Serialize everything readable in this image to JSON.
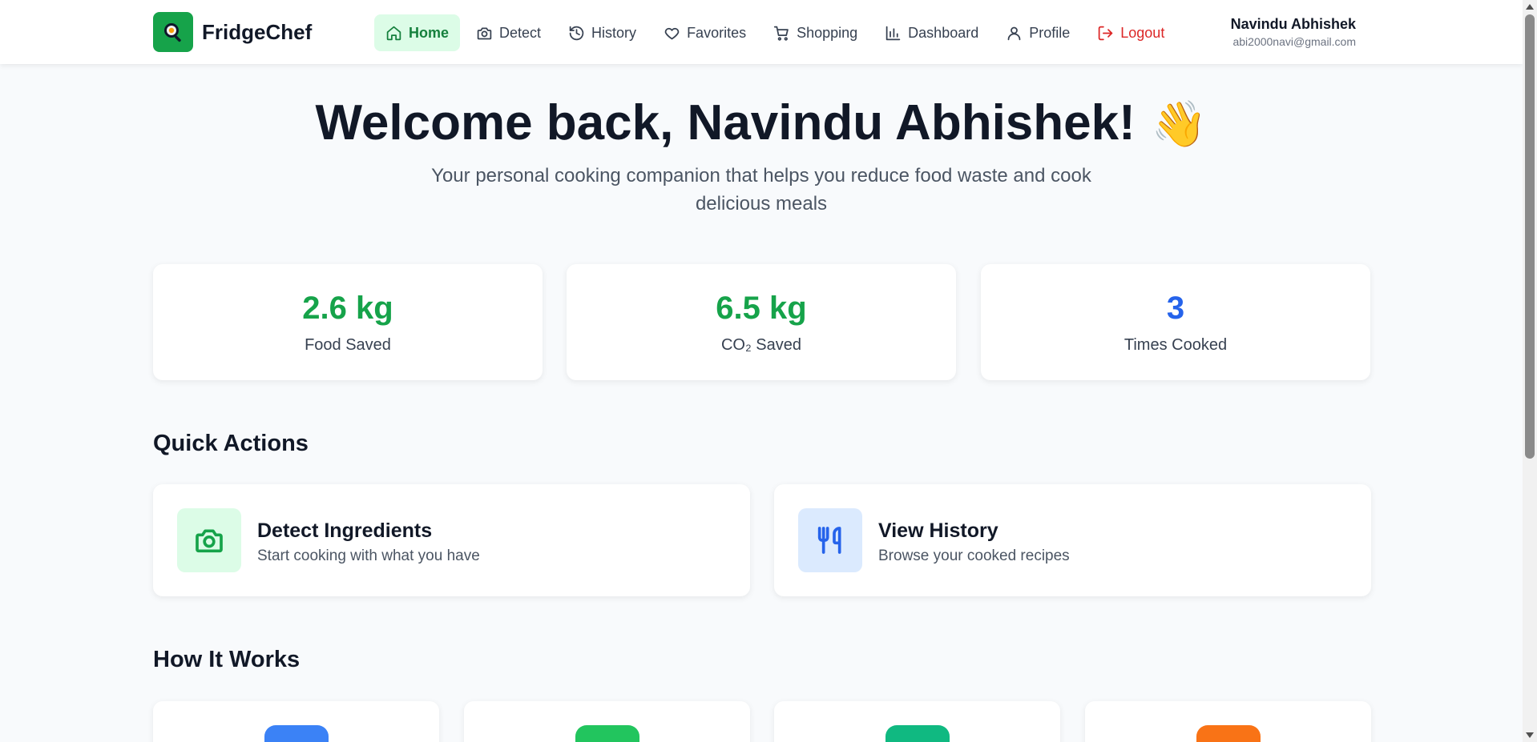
{
  "app": {
    "name": "FridgeChef",
    "logo_icon": "pan-icon"
  },
  "nav": {
    "items": [
      {
        "label": "Home",
        "icon": "home-icon",
        "active": true
      },
      {
        "label": "Detect",
        "icon": "camera-icon"
      },
      {
        "label": "History",
        "icon": "history-icon"
      },
      {
        "label": "Favorites",
        "icon": "heart-icon"
      },
      {
        "label": "Shopping",
        "icon": "cart-icon"
      },
      {
        "label": "Dashboard",
        "icon": "bar-chart-icon"
      },
      {
        "label": "Profile",
        "icon": "user-icon"
      },
      {
        "label": "Logout",
        "icon": "logout-icon"
      }
    ]
  },
  "user": {
    "name": "Navindu Abhishek",
    "email": "abi2000navi@gmail.com"
  },
  "hero": {
    "title": "Welcome back, Navindu Abhishek!",
    "emoji": "👋",
    "subtitle": "Your personal cooking companion that helps you reduce food waste and cook delicious meals"
  },
  "stats": [
    {
      "value": "2.6 kg",
      "label": "Food Saved",
      "color": "#16a34a"
    },
    {
      "value": "6.5 kg",
      "label": "CO₂ Saved",
      "color": "#16a34a"
    },
    {
      "value": "3",
      "label": "Times Cooked",
      "color": "#2563eb"
    }
  ],
  "quick_actions": {
    "title": "Quick Actions",
    "items": [
      {
        "title": "Detect Ingredients",
        "description": "Start cooking with what you have",
        "icon": "camera-icon",
        "color": "#16a34a",
        "bg": "#dcfce7"
      },
      {
        "title": "View History",
        "description": "Browse your cooked recipes",
        "icon": "utensils-icon",
        "color": "#2563eb",
        "bg": "#dbeafe"
      }
    ]
  },
  "how_it_works": {
    "title": "How It Works",
    "badge_colors": [
      "#3b82f6",
      "#22c55e",
      "#10b981",
      "#f97316"
    ]
  }
}
